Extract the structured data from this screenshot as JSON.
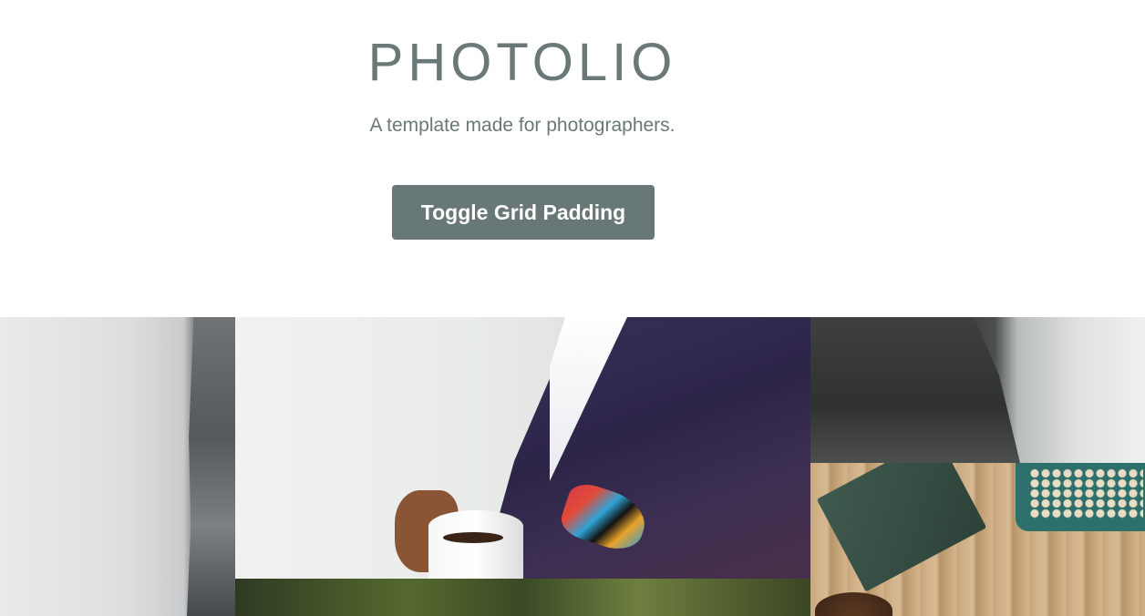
{
  "header": {
    "title": "PHOTOLIO",
    "subtitle": "A template made for photographers.",
    "toggle_button_label": "Toggle Grid Padding"
  },
  "colors": {
    "title": "#6a7877",
    "button_bg": "#687877",
    "button_text": "#ffffff",
    "page_bg": "#ffffff"
  },
  "grid": {
    "tiles": [
      {
        "name": "misty cliff photo"
      },
      {
        "name": "man in suit holding coffee photo"
      },
      {
        "name": "forest photo"
      },
      {
        "name": "foggy mountain photo"
      },
      {
        "name": "typewriter on wooden table photo"
      }
    ]
  }
}
